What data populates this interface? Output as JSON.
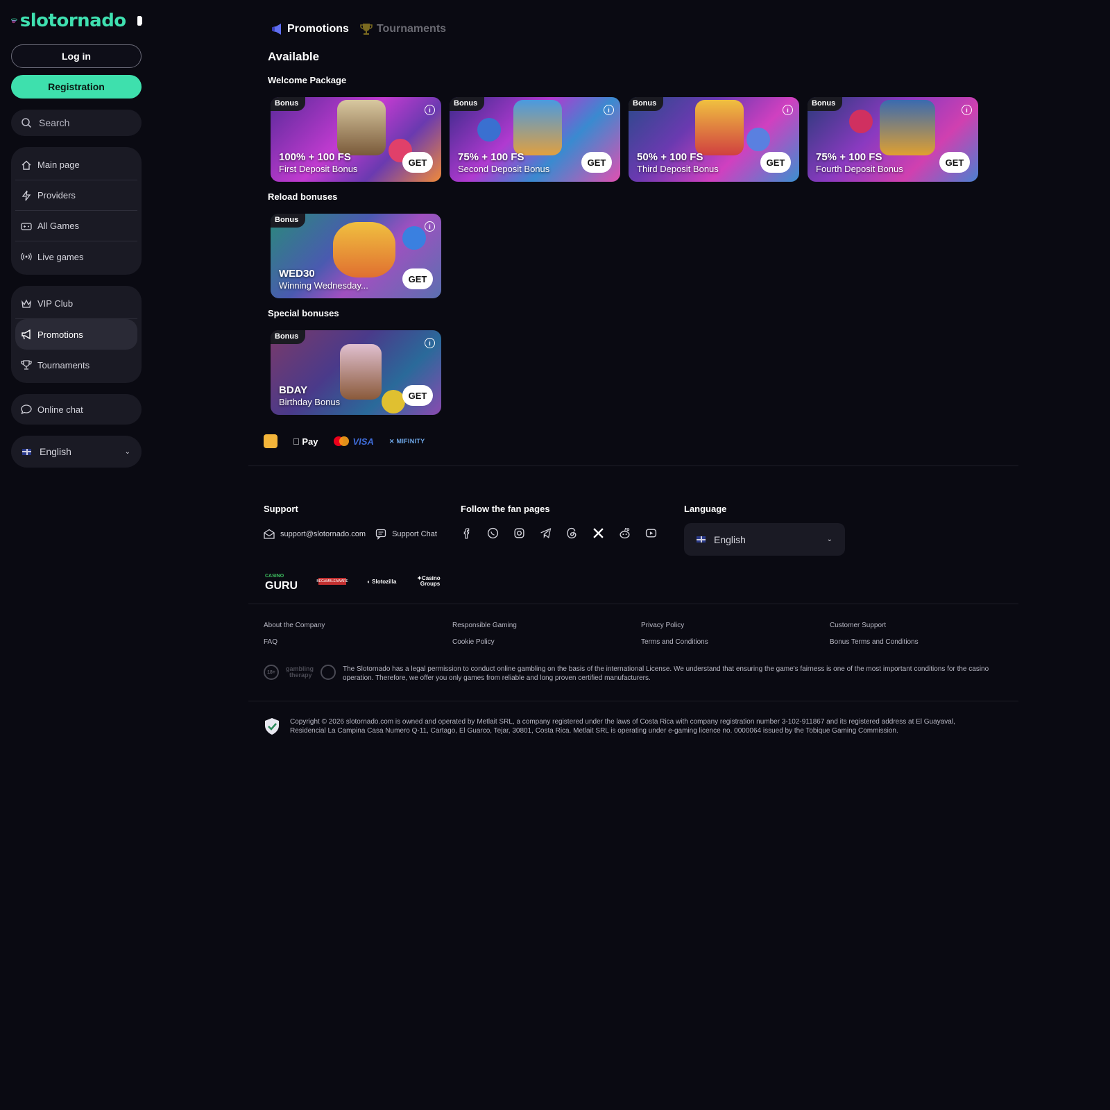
{
  "brand": {
    "name": "slotornado",
    "accent": "#3ee0ad"
  },
  "sidebar": {
    "login_label": "Log in",
    "register_label": "Registration",
    "search_placeholder": "Search",
    "nav_main": [
      {
        "label": "Main page",
        "icon": "home-icon"
      },
      {
        "label": "Providers",
        "icon": "lightning-icon"
      },
      {
        "label": "All Games",
        "icon": "gamepad-icon"
      },
      {
        "label": "Live games",
        "icon": "broadcast-icon"
      }
    ],
    "nav_extra": [
      {
        "label": "VIP Club",
        "icon": "crown-icon"
      },
      {
        "label": "Promotions",
        "icon": "megaphone-icon",
        "active": true
      },
      {
        "label": "Tournaments",
        "icon": "trophy-icon"
      }
    ],
    "chat_label": "Online chat",
    "language": "English"
  },
  "tabs": [
    {
      "label": "Promotions",
      "active": true
    },
    {
      "label": "Tournaments",
      "active": false
    }
  ],
  "available_title": "Available",
  "sections": {
    "welcome": {
      "title": "Welcome Package",
      "cards": [
        {
          "badge": "Bonus",
          "headline": "100% + 100 FS",
          "subtitle": "First Deposit Bonus",
          "cta": "GET"
        },
        {
          "badge": "Bonus",
          "headline": "75% + 100 FS",
          "subtitle": "Second Deposit Bonus",
          "cta": "GET"
        },
        {
          "badge": "Bonus",
          "headline": "50% + 100 FS",
          "subtitle": "Third Deposit Bonus",
          "cta": "GET"
        },
        {
          "badge": "Bonus",
          "headline": "75% + 100 FS",
          "subtitle": "Fourth Deposit Bonus",
          "cta": "GET"
        }
      ]
    },
    "reload": {
      "title": "Reload bonuses",
      "cards": [
        {
          "badge": "Bonus",
          "headline": "WED30",
          "subtitle": "Winning Wednesday...",
          "cta": "GET"
        }
      ]
    },
    "special": {
      "title": "Special bonuses",
      "cards": [
        {
          "badge": "Bonus",
          "headline": "BDAY",
          "subtitle": "Birthday Bonus",
          "cta": "GET"
        }
      ]
    }
  },
  "payments": {
    "apple_pay": "Pay",
    "visa": "VISA",
    "mifinity": "MIFINITY"
  },
  "footer": {
    "support_title": "Support",
    "support_email": "support@slotornado.com",
    "support_chat": "Support Chat",
    "fan_title": "Follow the fan pages",
    "social_icons": [
      "facebook-icon",
      "whatsapp-icon",
      "instagram-icon",
      "telegram-icon",
      "threads-icon",
      "x-icon",
      "reddit-icon",
      "youtube-icon"
    ],
    "language_title": "Language",
    "language_value": "English",
    "partners": {
      "guru_small": "CASINO",
      "guru": "GURU",
      "begambleaware": "BEGAMBLEAWARE",
      "slotozilla": "Slotozilla",
      "casino_groups": [
        "Casino",
        "Groups"
      ]
    },
    "links": [
      "About the Company",
      "Responsible Gaming",
      "Privacy Policy",
      "Customer Support",
      "FAQ",
      "Cookie Policy",
      "Terms and Conditions",
      "Bonus Terms and Conditions"
    ],
    "license_badges": {
      "age": "18+",
      "gambling_therapy": [
        "gambling",
        "therapy"
      ]
    },
    "license_text": "The Slotornado has a legal permission to conduct online gambling on the basis of the international License. We understand that ensuring the game's fairness is one of the most important conditions for the casino operation. Therefore, we offer you only games from reliable and long proven certified manufacturers.",
    "copyright": "Copyright © 2026 slotornado.com is owned and operated by Metlait SRL, a company registered under the laws of Costa Rica with company registration number 3-102-911867 and its registered address at El Guayaval, Residencial La Campina Casa Numero Q-11, Cartago, El Guarco, Tejar, 30801, Costa Rica. Metlait SRL is operating under e-gaming licence no. 0000064 issued by the Tobique Gaming Commission."
  }
}
